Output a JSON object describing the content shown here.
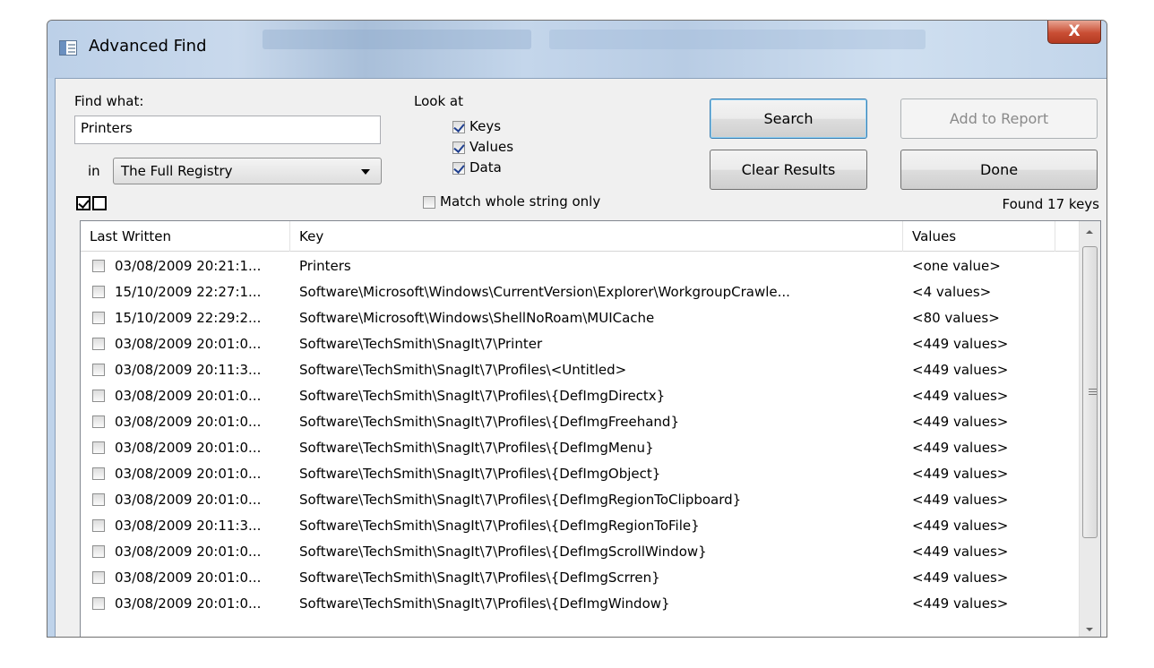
{
  "window": {
    "title": "Advanced Find",
    "close_glyph": "X"
  },
  "find": {
    "find_what_label": "Find what:",
    "find_what_value": "Printers",
    "in_label": "in",
    "in_value": "The Full Registry",
    "look_at_label": "Look at",
    "look_at": [
      {
        "label": "Keys",
        "checked": true
      },
      {
        "label": "Values",
        "checked": true
      },
      {
        "label": "Data",
        "checked": true
      }
    ],
    "match_whole": {
      "label": "Match whole string only",
      "checked": false
    }
  },
  "buttons": {
    "search": "Search",
    "clear_results": "Clear Results",
    "add_to_report": "Add to Report",
    "done": "Done"
  },
  "status": {
    "found": "Found 17 keys"
  },
  "list": {
    "columns": [
      "Last Written",
      "Key",
      "Values"
    ],
    "rows": [
      {
        "last_written": "03/08/2009 20:21:1...",
        "key": "Printers",
        "values": "<one value>"
      },
      {
        "last_written": "15/10/2009 22:27:1...",
        "key": "Software\\Microsoft\\Windows\\CurrentVersion\\Explorer\\WorkgroupCrawle...",
        "values": "<4 values>"
      },
      {
        "last_written": "15/10/2009 22:29:2...",
        "key": "Software\\Microsoft\\Windows\\ShellNoRoam\\MUICache",
        "values": "<80 values>"
      },
      {
        "last_written": "03/08/2009 20:01:0...",
        "key": "Software\\TechSmith\\SnagIt\\7\\Printer",
        "values": "<449 values>"
      },
      {
        "last_written": "03/08/2009 20:11:3...",
        "key": "Software\\TechSmith\\SnagIt\\7\\Profiles\\<Untitled>",
        "values": "<449 values>"
      },
      {
        "last_written": "03/08/2009 20:01:0...",
        "key": "Software\\TechSmith\\SnagIt\\7\\Profiles\\{DefImgDirectx}",
        "values": "<449 values>"
      },
      {
        "last_written": "03/08/2009 20:01:0...",
        "key": "Software\\TechSmith\\SnagIt\\7\\Profiles\\{DefImgFreehand}",
        "values": "<449 values>"
      },
      {
        "last_written": "03/08/2009 20:01:0...",
        "key": "Software\\TechSmith\\SnagIt\\7\\Profiles\\{DefImgMenu}",
        "values": "<449 values>"
      },
      {
        "last_written": "03/08/2009 20:01:0...",
        "key": "Software\\TechSmith\\SnagIt\\7\\Profiles\\{DefImgObject}",
        "values": "<449 values>"
      },
      {
        "last_written": "03/08/2009 20:01:0...",
        "key": "Software\\TechSmith\\SnagIt\\7\\Profiles\\{DefImgRegionToClipboard}",
        "values": "<449 values>"
      },
      {
        "last_written": "03/08/2009 20:11:3...",
        "key": "Software\\TechSmith\\SnagIt\\7\\Profiles\\{DefImgRegionToFile}",
        "values": "<449 values>"
      },
      {
        "last_written": "03/08/2009 20:01:0...",
        "key": "Software\\TechSmith\\SnagIt\\7\\Profiles\\{DefImgScrollWindow}",
        "values": "<449 values>"
      },
      {
        "last_written": "03/08/2009 20:01:0...",
        "key": "Software\\TechSmith\\SnagIt\\7\\Profiles\\{DefImgScrren}",
        "values": "<449 values>"
      },
      {
        "last_written": "03/08/2009 20:01:0...",
        "key": "Software\\TechSmith\\SnagIt\\7\\Profiles\\{DefImgWindow}",
        "values": "<449 values>"
      }
    ]
  },
  "icons": {
    "app": "window-app-icon",
    "close": "close-icon",
    "combo": "chevron-down-icon",
    "check_all": "check-all-icon",
    "uncheck_all": "uncheck-all-icon",
    "grip": "scroll-grip-icon"
  },
  "colors": {
    "close_button": "#c94e34",
    "titlebar": "#bfd3ea",
    "default_button_border": "#3c7fb1"
  }
}
